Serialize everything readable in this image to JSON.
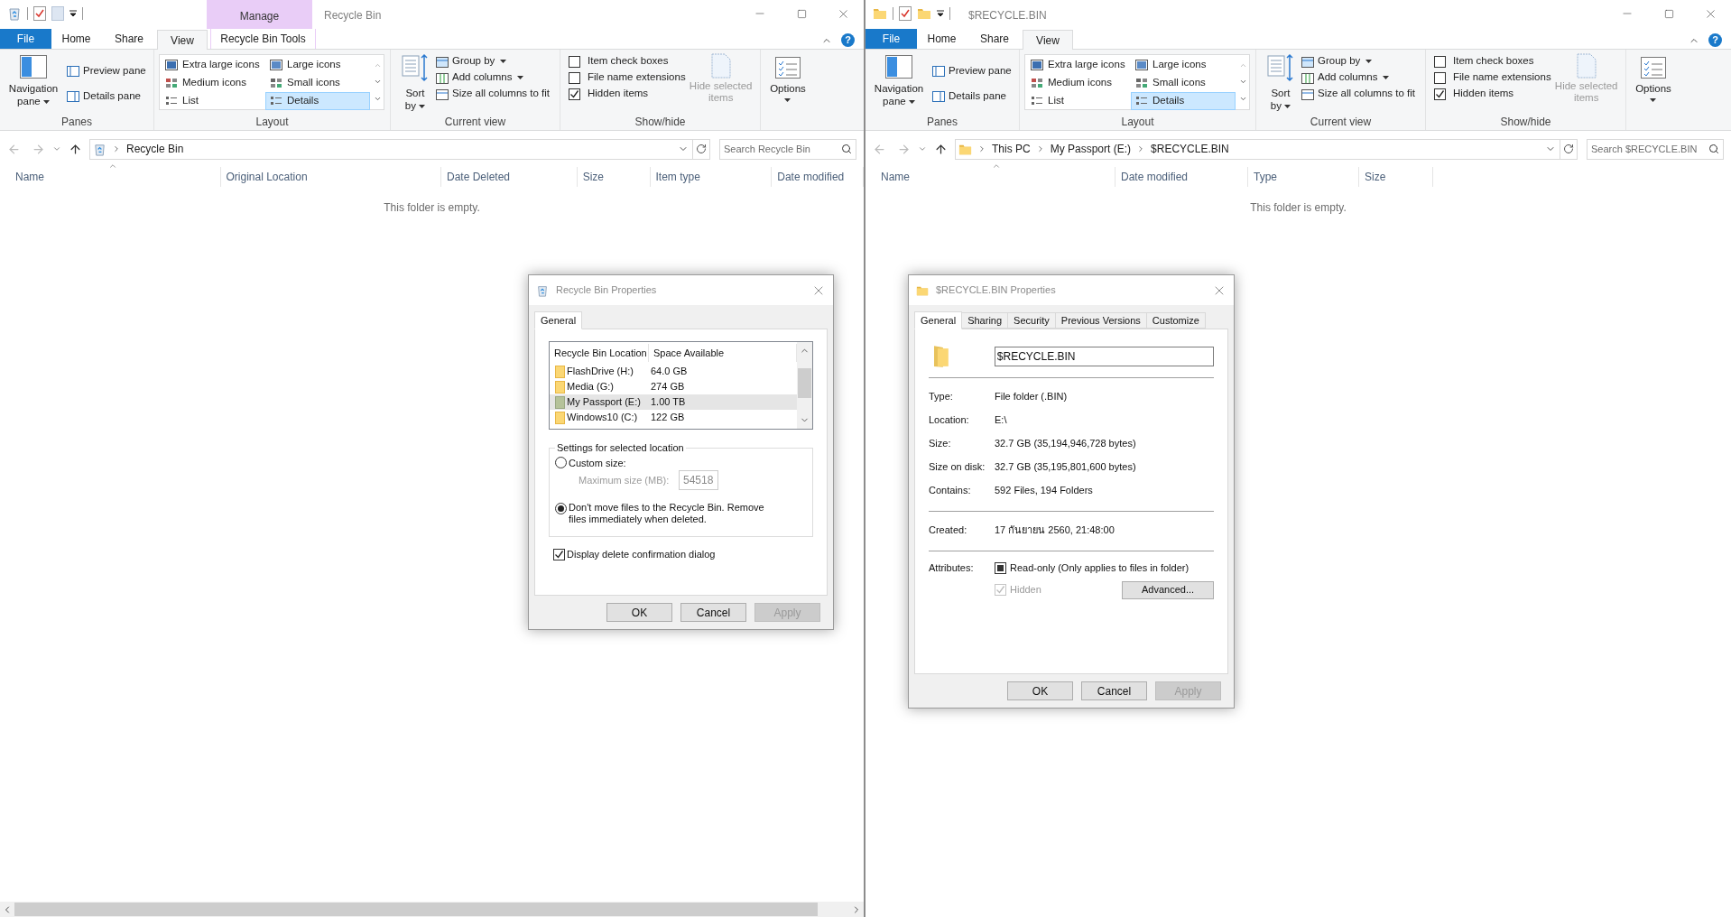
{
  "windows": [
    {
      "kind": "recycle-bin",
      "title": "Recycle Bin",
      "context_group": "Manage",
      "help": "?",
      "horizontal_scrollbar": true,
      "tabs": [
        {
          "label": "File",
          "kind": "file",
          "selected": false
        },
        {
          "label": "Home",
          "kind": "plain",
          "selected": false
        },
        {
          "label": "Share",
          "kind": "plain",
          "selected": false
        },
        {
          "label": "View",
          "kind": "plain",
          "selected": true
        },
        {
          "label": "Recycle Bin Tools",
          "kind": "context",
          "selected": false
        }
      ],
      "ribbon": {
        "panes": {
          "label": "Panes",
          "big": "Navigation pane",
          "items": [
            "Preview pane",
            "Details pane"
          ]
        },
        "layout": {
          "label": "Layout",
          "items": [
            {
              "label": "Extra large icons",
              "selected": false
            },
            {
              "label": "Large icons",
              "selected": false
            },
            {
              "label": "Medium icons",
              "selected": false
            },
            {
              "label": "Small icons",
              "selected": false
            },
            {
              "label": "List",
              "selected": false
            },
            {
              "label": "Details",
              "selected": true
            }
          ]
        },
        "current_view": {
          "label": "Current view",
          "big": "Sort by",
          "items": [
            {
              "label": "Group by",
              "dropdown": true
            },
            {
              "label": "Add columns",
              "dropdown": true
            },
            {
              "label": "Size all columns to fit",
              "dropdown": false
            }
          ]
        },
        "show_hide": {
          "label": "Show/hide",
          "checks": [
            {
              "label": "Item check boxes",
              "checked": false
            },
            {
              "label": "File name extensions",
              "checked": false
            },
            {
              "label": "Hidden items",
              "checked": true
            }
          ],
          "hide_selected": {
            "label": "Hide selected items",
            "disabled": true
          }
        },
        "options": "Options"
      },
      "address": {
        "crumbs": [
          "Recycle Bin"
        ],
        "search_placeholder": "Search Recycle Bin"
      },
      "columns": [
        "Name",
        "Original Location",
        "Date Deleted",
        "Size",
        "Item type",
        "Date modified"
      ],
      "empty_message": "This folder is empty."
    },
    {
      "kind": "folder",
      "title": "$RECYCLE.BIN",
      "help": "?",
      "horizontal_scrollbar": false,
      "tabs": [
        {
          "label": "File",
          "kind": "file",
          "selected": false
        },
        {
          "label": "Home",
          "kind": "plain",
          "selected": false
        },
        {
          "label": "Share",
          "kind": "plain",
          "selected": false
        },
        {
          "label": "View",
          "kind": "plain",
          "selected": true
        }
      ],
      "ribbon": {
        "panes": {
          "label": "Panes",
          "big": "Navigation pane",
          "items": [
            "Preview pane",
            "Details pane"
          ]
        },
        "layout": {
          "label": "Layout",
          "items": [
            {
              "label": "Extra large icons",
              "selected": false
            },
            {
              "label": "Large icons",
              "selected": false
            },
            {
              "label": "Medium icons",
              "selected": false
            },
            {
              "label": "Small icons",
              "selected": false
            },
            {
              "label": "List",
              "selected": false
            },
            {
              "label": "Details",
              "selected": true
            }
          ]
        },
        "current_view": {
          "label": "Current view",
          "big": "Sort by",
          "items": [
            {
              "label": "Group by",
              "dropdown": true
            },
            {
              "label": "Add columns",
              "dropdown": true
            },
            {
              "label": "Size all columns to fit",
              "dropdown": false
            }
          ]
        },
        "show_hide": {
          "label": "Show/hide",
          "checks": [
            {
              "label": "Item check boxes",
              "checked": false
            },
            {
              "label": "File name extensions",
              "checked": false
            },
            {
              "label": "Hidden items",
              "checked": true
            }
          ],
          "hide_selected": {
            "label": "Hide selected items",
            "disabled": true
          }
        },
        "options": "Options"
      },
      "address": {
        "crumbs": [
          "This PC",
          "My Passport (E:)",
          "$RECYCLE.BIN"
        ],
        "search_placeholder": "Search $RECYCLE.BIN"
      },
      "columns": [
        "Name",
        "Date modified",
        "Type",
        "Size"
      ],
      "empty_message": "This folder is empty."
    }
  ],
  "dialogs": [
    {
      "kind": "recycle",
      "title": "Recycle Bin Properties",
      "tabs": [
        {
          "label": "General",
          "selected": true
        }
      ],
      "list": {
        "columns": [
          "Recycle Bin Location",
          "Space Available"
        ],
        "rows": [
          {
            "name": "FlashDrive (H:)",
            "space": "64.0 GB",
            "selected": false
          },
          {
            "name": "Media (G:)",
            "space": "274 GB",
            "selected": false
          },
          {
            "name": "My Passport (E:)",
            "space": "1.00 TB",
            "selected": true
          },
          {
            "name": "Windows10 (C:)",
            "space": "122 GB",
            "selected": false
          }
        ]
      },
      "settings": {
        "legend": "Settings for selected location",
        "custom": {
          "label": "Custom size:",
          "selected": false
        },
        "max_label": "Maximum size (MB):",
        "max_value": "54518",
        "max_disabled": true,
        "dont_move": {
          "label": "Don't move files to the Recycle Bin. Remove files immediately when deleted.",
          "selected": true
        }
      },
      "confirm": {
        "label": "Display delete confirmation dialog",
        "checked": true
      },
      "buttons": [
        {
          "label": "OK",
          "disabled": false
        },
        {
          "label": "Cancel",
          "disabled": false
        },
        {
          "label": "Apply",
          "disabled": true
        }
      ]
    },
    {
      "kind": "folder",
      "title": "$RECYCLE.BIN Properties",
      "tabs": [
        {
          "label": "General",
          "selected": true
        },
        {
          "label": "Sharing",
          "selected": false
        },
        {
          "label": "Security",
          "selected": false
        },
        {
          "label": "Previous Versions",
          "selected": false
        },
        {
          "label": "Customize",
          "selected": false
        }
      ],
      "name_value": "$RECYCLE.BIN",
      "sections": [
        [
          {
            "label": "Type:",
            "value": "File folder (.BIN)"
          },
          {
            "label": "Location:",
            "value": "E:\\"
          },
          {
            "label": "Size:",
            "value": "32.7 GB (35,194,946,728 bytes)"
          },
          {
            "label": "Size on disk:",
            "value": "32.7 GB (35,195,801,600 bytes)"
          },
          {
            "label": "Contains:",
            "value": "592 Files, 194 Folders"
          }
        ],
        [
          {
            "label": "Created:",
            "value": "17 กันยายน 2560, 21:48:00"
          }
        ]
      ],
      "attributes": {
        "label": "Attributes:",
        "checks": [
          {
            "label": "Read-only (Only applies to files in folder)",
            "indeterminate": true,
            "disabled": false
          },
          {
            "label": "Hidden",
            "checked": true,
            "disabled": true
          }
        ],
        "advanced": "Advanced..."
      },
      "buttons": [
        {
          "label": "OK",
          "disabled": false
        },
        {
          "label": "Cancel",
          "disabled": false
        },
        {
          "label": "Apply",
          "disabled": true
        }
      ]
    }
  ]
}
